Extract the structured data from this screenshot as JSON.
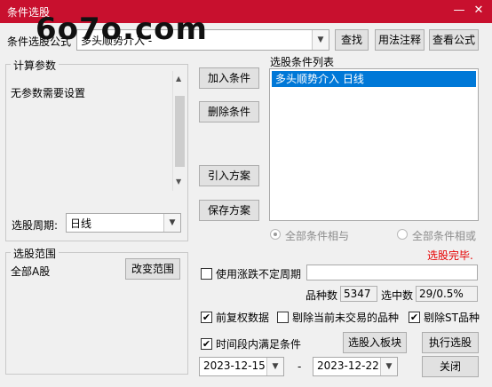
{
  "window": {
    "title": "条件选股",
    "minimize": "—",
    "close": "✕"
  },
  "watermark": "6o7o.com",
  "formula": {
    "label": "条件选股公式",
    "value": "多头顺势介入 -",
    "find_button": "查找",
    "usage_button": "用法注释",
    "view_button": "查看公式"
  },
  "params": {
    "title": "计算参数",
    "text": "无参数需要设置"
  },
  "period": {
    "label": "选股周期:",
    "value": "日线"
  },
  "actions": {
    "add": "加入条件",
    "delete": "删除条件",
    "import": "引入方案",
    "save": "保存方案"
  },
  "conditions": {
    "title": "选股条件列表",
    "items": [
      "多头顺势介入  日线"
    ]
  },
  "logic": {
    "and_label": "全部条件相与",
    "or_label": "全部条件相或"
  },
  "status": "选股完毕.",
  "scope": {
    "title": "选股范围",
    "value": "全部A股",
    "change_button": "改变范围"
  },
  "options": {
    "variable_period": {
      "label": "使用涨跌不定周期",
      "checked": false,
      "value": ""
    },
    "count_label": "品种数",
    "count_value": "5347",
    "selected_label": "选中数",
    "selected_value": "29/0.5%",
    "pre_adjust": {
      "label": "前复权数据",
      "checked": true
    },
    "exclude_untraded": {
      "label": "剔除当前未交易的品种",
      "checked": false
    },
    "exclude_st": {
      "label": "剔除ST品种",
      "checked": true
    },
    "time_range": {
      "label": "时间段内满足条件",
      "checked": true
    }
  },
  "buttons": {
    "to_block": "选股入板块",
    "execute": "执行选股",
    "close": "关闭"
  },
  "dates": {
    "start": "2023-12-15",
    "separator": "-",
    "end": "2023-12-22"
  },
  "icons": {
    "dropdown": "▼",
    "scroll_up": "▲",
    "scroll_down": "▼",
    "check": "✔"
  },
  "colors": {
    "titlebar": "#c8102e",
    "selection": "#0078d7",
    "status": "#e60000"
  }
}
